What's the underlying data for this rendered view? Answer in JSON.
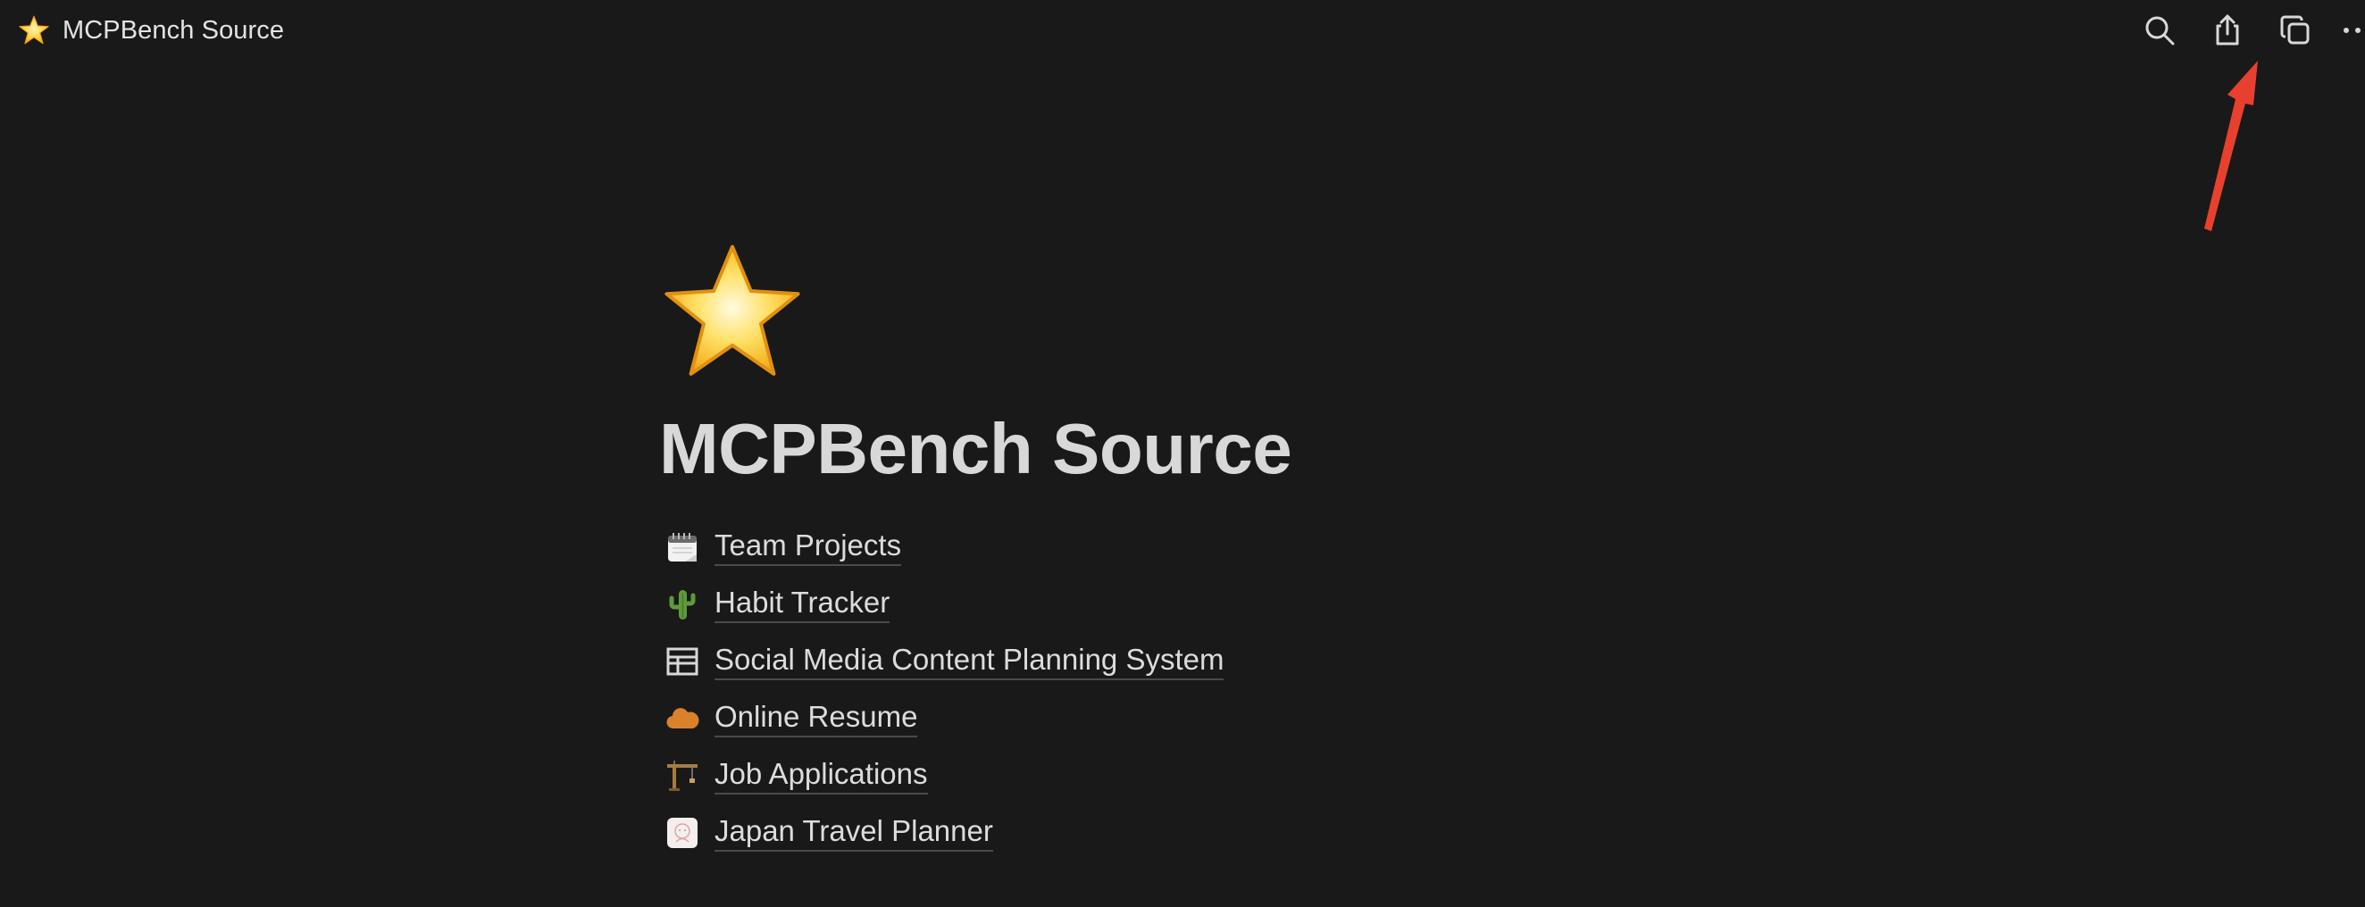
{
  "topbar": {
    "title": "MCPBench Source",
    "page_icon": "star-icon",
    "actions": [
      {
        "name": "search",
        "icon": "search-icon"
      },
      {
        "name": "share",
        "icon": "share-icon"
      },
      {
        "name": "duplicate",
        "icon": "duplicate-icon"
      },
      {
        "name": "more",
        "icon": "more-icon"
      }
    ]
  },
  "page": {
    "icon": "star-icon",
    "title": "MCPBench Source",
    "links": [
      {
        "label": "Team Projects",
        "icon": "calendar-icon"
      },
      {
        "label": "Habit Tracker",
        "icon": "cactus-icon"
      },
      {
        "label": "Social Media Content Planning System",
        "icon": "layout-icon"
      },
      {
        "label": "Online Resume",
        "icon": "cloud-icon"
      },
      {
        "label": "Job Applications",
        "icon": "crane-icon"
      },
      {
        "label": "Japan Travel Planner",
        "icon": "japan-postcard-icon"
      }
    ]
  },
  "colors": {
    "background": "#191919",
    "text": "#d4d4d4",
    "annotation_arrow": "#e8402e"
  }
}
